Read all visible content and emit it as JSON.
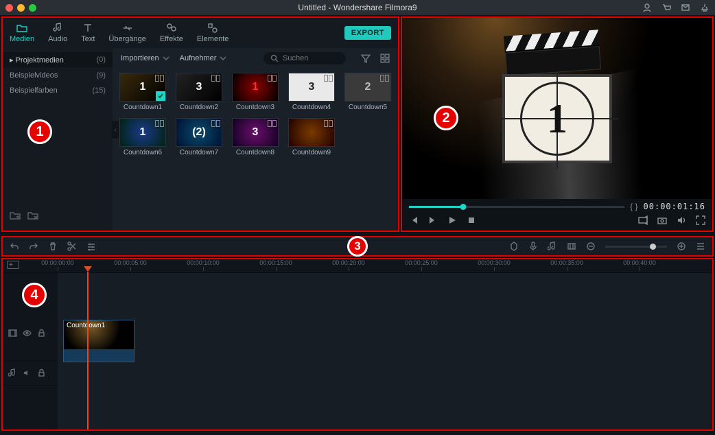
{
  "window_title": "Untitled - Wondershare Filmora9",
  "tabs": [
    {
      "id": "media",
      "label": "Medien",
      "icon": "folder"
    },
    {
      "id": "audio",
      "label": "Audio",
      "icon": "music"
    },
    {
      "id": "text",
      "label": "Text",
      "icon": "text"
    },
    {
      "id": "transitions",
      "label": "Übergänge",
      "icon": "transition"
    },
    {
      "id": "effects",
      "label": "Effekte",
      "icon": "sparkle"
    },
    {
      "id": "elements",
      "label": "Elemente",
      "icon": "shapes"
    }
  ],
  "export_label": "EXPORT",
  "sidebar": {
    "items": [
      {
        "label": "Projektmedien",
        "count": "(0)",
        "selected": true
      },
      {
        "label": "Beispielvideos",
        "count": "(9)"
      },
      {
        "label": "Beispielfarben",
        "count": "(15)"
      }
    ]
  },
  "media_toolbar": {
    "import": "Importieren",
    "record": "Aufnehmer",
    "search_placeholder": "Suchen"
  },
  "media_items": [
    {
      "label": "Countdown1",
      "num": "1",
      "bg": "linear-gradient(135deg,#3a2a0c,#000)",
      "checked": true
    },
    {
      "label": "Countdown2",
      "num": "3",
      "bg": "linear-gradient(135deg,#222,#000)"
    },
    {
      "label": "Countdown3",
      "num": "1",
      "bg": "radial-gradient(circle,#8b0000,#000)",
      "color": "#ff3030"
    },
    {
      "label": "Countdown4",
      "num": "3",
      "bg": "#e9e9e9",
      "color": "#222"
    },
    {
      "label": "Countdown5",
      "num": "2",
      "bg": "#3a3a3a",
      "color": "#bbb"
    },
    {
      "label": "Countdown6",
      "num": "1",
      "bg": "radial-gradient(circle,#1a3a8a,#021)"
    },
    {
      "label": "Countdown7",
      "num": "(2)",
      "bg": "radial-gradient(circle,#0a4a6a,#013)"
    },
    {
      "label": "Countdown8",
      "num": "3",
      "bg": "radial-gradient(circle,#6a106a,#102)"
    },
    {
      "label": "Countdown9",
      "num": " ",
      "bg": "radial-gradient(circle,#7a3a00,#200)"
    }
  ],
  "preview": {
    "countdown_num": "1",
    "timecode": "00:00:01:16",
    "progress_percent": 25
  },
  "midbar": {
    "tools": [
      "undo",
      "redo",
      "delete",
      "scissors",
      "sliders"
    ],
    "right": [
      "marker",
      "mic",
      "music",
      "crop",
      "zoom-out",
      "zoom-slider",
      "zoom-in",
      "settings"
    ]
  },
  "timeline": {
    "ruler": [
      "00:00:00:00",
      "00:00:05:00",
      "00:00:10:00",
      "00:00:15:00",
      "00:00:20:00",
      "00:00:25:00",
      "00:00:30:00",
      "00:00:35:00",
      "00:00:40:00"
    ],
    "clip_label": "Countdown1"
  },
  "badges": {
    "1": "1",
    "2": "2",
    "3": "3",
    "4": "4"
  }
}
